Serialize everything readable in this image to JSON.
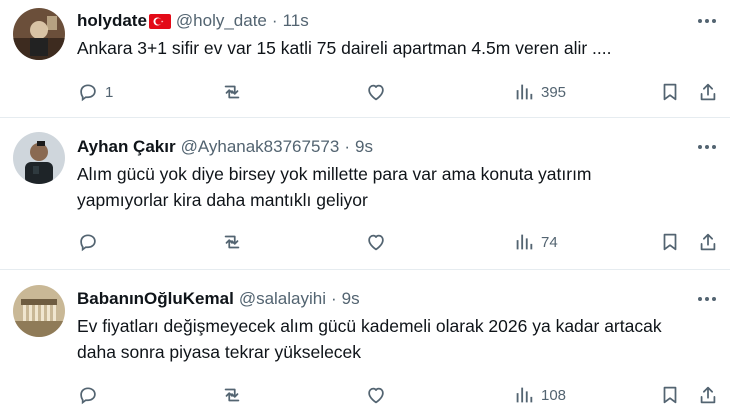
{
  "tweets": [
    {
      "name": "holydate",
      "handle": "@holy_date",
      "time": "11s",
      "text_lines": [
        "Ankara 3+1 sifir ev var 15 katli 75 daireli apartman 4.5m veren alir ...."
      ],
      "replies": "1",
      "views": "395",
      "avatar_color": "#6b4f3a",
      "has_flag": true
    },
    {
      "name": "Ayhan Çakır",
      "handle": "@Ayhanak83767573",
      "time": "9s",
      "text_lines": [
        "Alım gücü yok diye birsey yok millette para var ama konuta yatırım",
        "yapmıyorlar kira daha mantıklı geliyor"
      ],
      "replies": "",
      "views": "74",
      "avatar_color": "#2f3a3f",
      "has_flag": false
    },
    {
      "name": "BabanınOğluKemal",
      "handle": "@salalayihi",
      "time": "9s",
      "text_lines": [
        "Ev fiyatları değişmeyecek alım gücü kademeli olarak 2026 ya kadar artacak",
        "daha sonra piyasa tekrar yükselecek"
      ],
      "replies": "",
      "views": "108",
      "avatar_color": "#a8926a",
      "has_flag": false
    }
  ],
  "colors": {
    "text_primary": "#0f1419",
    "text_secondary": "#536471",
    "divider": "#e6ecf0",
    "flag_red": "#e30a17"
  },
  "icons": [
    "reply-icon",
    "retweet-icon",
    "like-icon",
    "views-icon",
    "bookmark-icon",
    "share-icon",
    "more-icon",
    "turkey-flag-icon"
  ]
}
